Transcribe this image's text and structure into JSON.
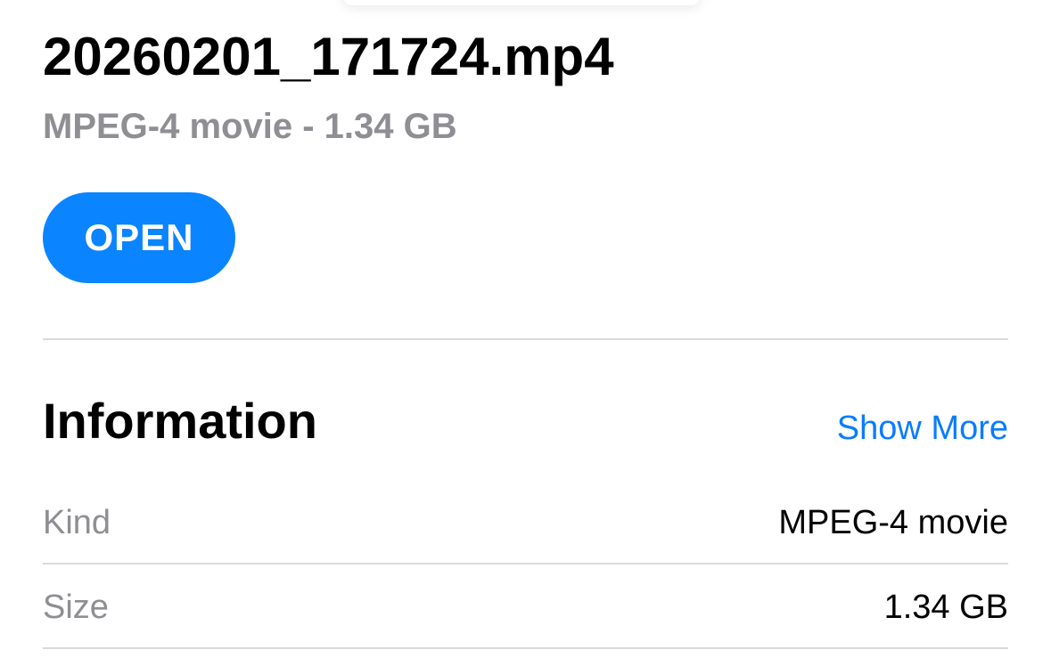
{
  "file": {
    "name": "20260201_171724.mp4",
    "subtitle": "MPEG-4 movie - 1.34 GB"
  },
  "actions": {
    "open_label": "OPEN"
  },
  "information": {
    "title": "Information",
    "show_more_label": "Show More",
    "rows": [
      {
        "label": "Kind",
        "value": "MPEG-4 movie"
      },
      {
        "label": "Size",
        "value": "1.34 GB"
      }
    ]
  },
  "colors": {
    "accent": "#0a84ff",
    "link": "#0a7cff",
    "secondary_text": "#8e8e93",
    "separator": "#d9d9de"
  }
}
